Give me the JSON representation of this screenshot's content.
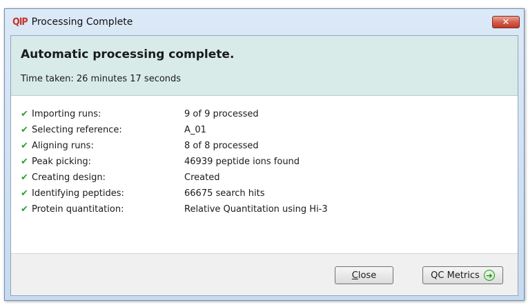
{
  "window": {
    "app_icon_text": "QIP",
    "title": "Processing Complete",
    "close_glyph": "✕"
  },
  "header": {
    "heading": "Automatic processing complete.",
    "time_taken": "Time taken: 26 minutes 17 seconds"
  },
  "steps": [
    {
      "label": "Importing runs:",
      "value": "9 of 9 processed",
      "icon": "check-icon"
    },
    {
      "label": "Selecting reference:",
      "value": "A_01",
      "icon": "check-icon"
    },
    {
      "label": "Aligning runs:",
      "value": "8 of 8 processed",
      "icon": "check-icon"
    },
    {
      "label": "Peak picking:",
      "value": "46939 peptide ions found",
      "icon": "check-icon"
    },
    {
      "label": "Creating design:",
      "value": "Created",
      "icon": "check-icon"
    },
    {
      "label": "Identifying peptides:",
      "value": "66675 search hits",
      "icon": "check-icon"
    },
    {
      "label": "Protein quantitation:",
      "value": "Relative Quantitation using Hi-3",
      "icon": "check-icon"
    }
  ],
  "footer": {
    "close_label_accel": "C",
    "close_label_rest": "lose",
    "qc_label": "QC Metrics",
    "qc_icon": "arrow-right-circle-icon"
  },
  "colors": {
    "header_band": "#d8ebe9",
    "check": "#2e9e2e",
    "title_close": "#c0392b"
  }
}
